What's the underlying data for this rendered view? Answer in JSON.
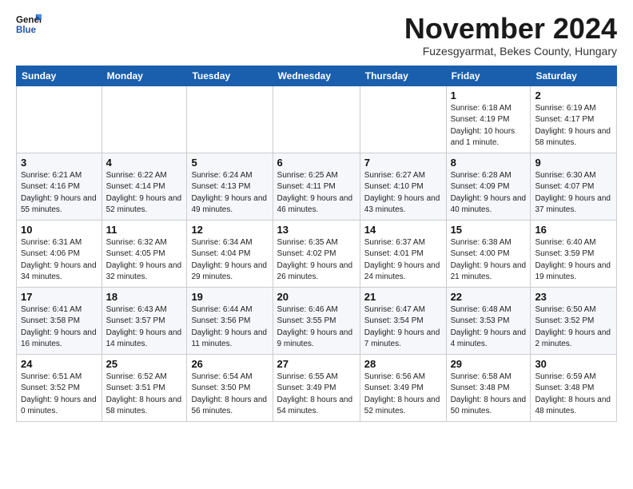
{
  "logo": {
    "line1": "General",
    "line2": "Blue"
  },
  "title": "November 2024",
  "subtitle": "Fuzesgyarmat, Bekes County, Hungary",
  "days_header": [
    "Sunday",
    "Monday",
    "Tuesday",
    "Wednesday",
    "Thursday",
    "Friday",
    "Saturday"
  ],
  "weeks": [
    [
      {
        "num": "",
        "info": ""
      },
      {
        "num": "",
        "info": ""
      },
      {
        "num": "",
        "info": ""
      },
      {
        "num": "",
        "info": ""
      },
      {
        "num": "",
        "info": ""
      },
      {
        "num": "1",
        "info": "Sunrise: 6:18 AM\nSunset: 4:19 PM\nDaylight: 10 hours and 1 minute."
      },
      {
        "num": "2",
        "info": "Sunrise: 6:19 AM\nSunset: 4:17 PM\nDaylight: 9 hours and 58 minutes."
      }
    ],
    [
      {
        "num": "3",
        "info": "Sunrise: 6:21 AM\nSunset: 4:16 PM\nDaylight: 9 hours and 55 minutes."
      },
      {
        "num": "4",
        "info": "Sunrise: 6:22 AM\nSunset: 4:14 PM\nDaylight: 9 hours and 52 minutes."
      },
      {
        "num": "5",
        "info": "Sunrise: 6:24 AM\nSunset: 4:13 PM\nDaylight: 9 hours and 49 minutes."
      },
      {
        "num": "6",
        "info": "Sunrise: 6:25 AM\nSunset: 4:11 PM\nDaylight: 9 hours and 46 minutes."
      },
      {
        "num": "7",
        "info": "Sunrise: 6:27 AM\nSunset: 4:10 PM\nDaylight: 9 hours and 43 minutes."
      },
      {
        "num": "8",
        "info": "Sunrise: 6:28 AM\nSunset: 4:09 PM\nDaylight: 9 hours and 40 minutes."
      },
      {
        "num": "9",
        "info": "Sunrise: 6:30 AM\nSunset: 4:07 PM\nDaylight: 9 hours and 37 minutes."
      }
    ],
    [
      {
        "num": "10",
        "info": "Sunrise: 6:31 AM\nSunset: 4:06 PM\nDaylight: 9 hours and 34 minutes."
      },
      {
        "num": "11",
        "info": "Sunrise: 6:32 AM\nSunset: 4:05 PM\nDaylight: 9 hours and 32 minutes."
      },
      {
        "num": "12",
        "info": "Sunrise: 6:34 AM\nSunset: 4:04 PM\nDaylight: 9 hours and 29 minutes."
      },
      {
        "num": "13",
        "info": "Sunrise: 6:35 AM\nSunset: 4:02 PM\nDaylight: 9 hours and 26 minutes."
      },
      {
        "num": "14",
        "info": "Sunrise: 6:37 AM\nSunset: 4:01 PM\nDaylight: 9 hours and 24 minutes."
      },
      {
        "num": "15",
        "info": "Sunrise: 6:38 AM\nSunset: 4:00 PM\nDaylight: 9 hours and 21 minutes."
      },
      {
        "num": "16",
        "info": "Sunrise: 6:40 AM\nSunset: 3:59 PM\nDaylight: 9 hours and 19 minutes."
      }
    ],
    [
      {
        "num": "17",
        "info": "Sunrise: 6:41 AM\nSunset: 3:58 PM\nDaylight: 9 hours and 16 minutes."
      },
      {
        "num": "18",
        "info": "Sunrise: 6:43 AM\nSunset: 3:57 PM\nDaylight: 9 hours and 14 minutes."
      },
      {
        "num": "19",
        "info": "Sunrise: 6:44 AM\nSunset: 3:56 PM\nDaylight: 9 hours and 11 minutes."
      },
      {
        "num": "20",
        "info": "Sunrise: 6:46 AM\nSunset: 3:55 PM\nDaylight: 9 hours and 9 minutes."
      },
      {
        "num": "21",
        "info": "Sunrise: 6:47 AM\nSunset: 3:54 PM\nDaylight: 9 hours and 7 minutes."
      },
      {
        "num": "22",
        "info": "Sunrise: 6:48 AM\nSunset: 3:53 PM\nDaylight: 9 hours and 4 minutes."
      },
      {
        "num": "23",
        "info": "Sunrise: 6:50 AM\nSunset: 3:52 PM\nDaylight: 9 hours and 2 minutes."
      }
    ],
    [
      {
        "num": "24",
        "info": "Sunrise: 6:51 AM\nSunset: 3:52 PM\nDaylight: 9 hours and 0 minutes."
      },
      {
        "num": "25",
        "info": "Sunrise: 6:52 AM\nSunset: 3:51 PM\nDaylight: 8 hours and 58 minutes."
      },
      {
        "num": "26",
        "info": "Sunrise: 6:54 AM\nSunset: 3:50 PM\nDaylight: 8 hours and 56 minutes."
      },
      {
        "num": "27",
        "info": "Sunrise: 6:55 AM\nSunset: 3:49 PM\nDaylight: 8 hours and 54 minutes."
      },
      {
        "num": "28",
        "info": "Sunrise: 6:56 AM\nSunset: 3:49 PM\nDaylight: 8 hours and 52 minutes."
      },
      {
        "num": "29",
        "info": "Sunrise: 6:58 AM\nSunset: 3:48 PM\nDaylight: 8 hours and 50 minutes."
      },
      {
        "num": "30",
        "info": "Sunrise: 6:59 AM\nSunset: 3:48 PM\nDaylight: 8 hours and 48 minutes."
      }
    ]
  ]
}
